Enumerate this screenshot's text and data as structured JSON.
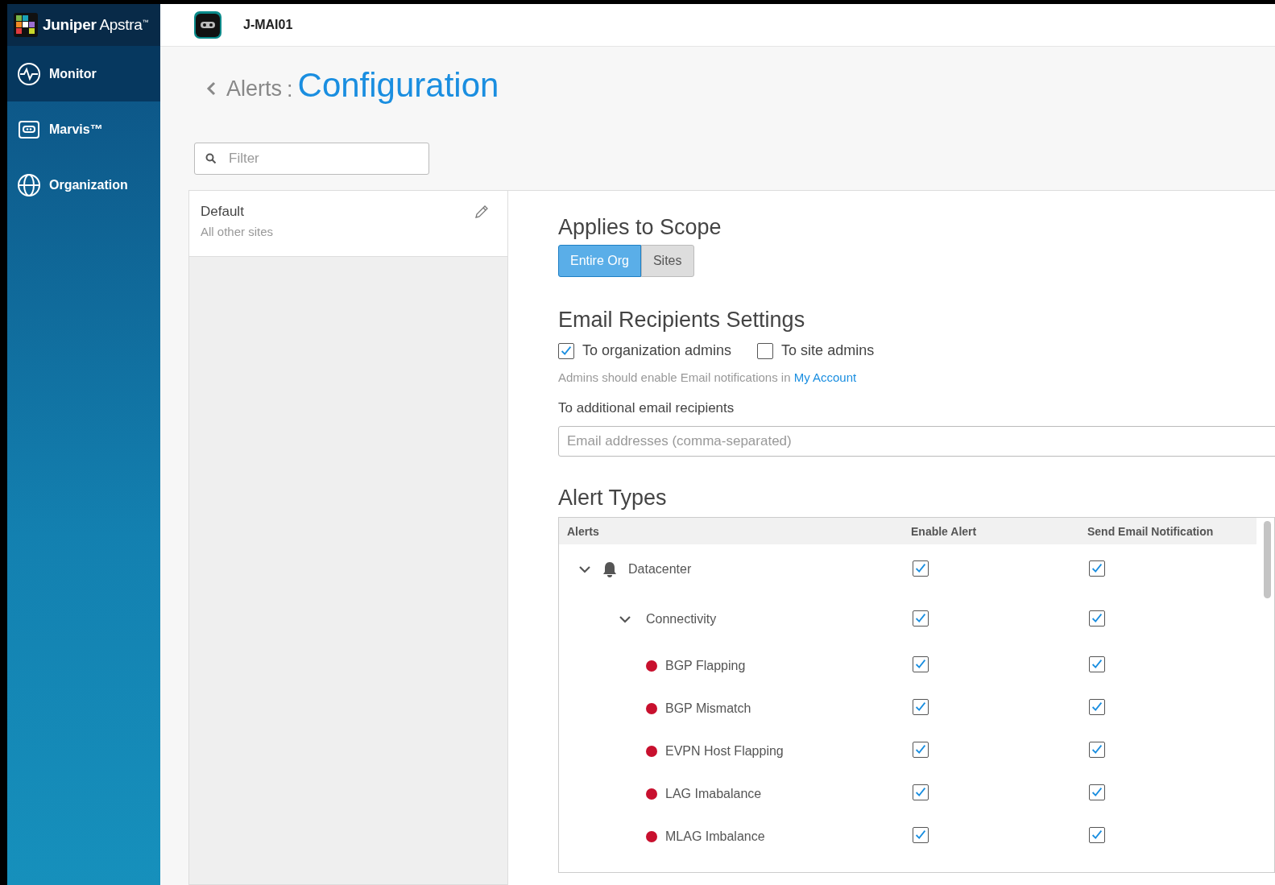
{
  "brand": {
    "name": "Juniper",
    "product": "Apstra",
    "mark": "™"
  },
  "header": {
    "org_name": "J-MAI01"
  },
  "sidebar": {
    "items": [
      {
        "label": "Monitor",
        "selected": true
      },
      {
        "label": "Marvis™",
        "selected": false
      },
      {
        "label": "Organization",
        "selected": false
      }
    ]
  },
  "breadcrumb": {
    "back": "Alerts",
    "separator": ":",
    "title": "Configuration"
  },
  "filter": {
    "placeholder": "Filter"
  },
  "templates": [
    {
      "name": "Default",
      "subtitle": "All other sites",
      "selected": true
    }
  ],
  "scope": {
    "heading": "Applies to Scope",
    "options": [
      {
        "label": "Entire Org",
        "selected": true
      },
      {
        "label": "Sites",
        "selected": false
      }
    ]
  },
  "email": {
    "heading": "Email Recipients Settings",
    "recipients": [
      {
        "label": "To organization admins",
        "checked": true
      },
      {
        "label": "To site admins",
        "checked": false
      }
    ],
    "hint": "Admins should enable Email notifications in",
    "hint_link": "My Account",
    "additional_label": "To additional email recipients",
    "additional_placeholder": "Email addresses (comma-separated)"
  },
  "alert_types": {
    "heading": "Alert Types",
    "columns": [
      "Alerts",
      "Enable Alert",
      "Send Email Notification"
    ],
    "rows": [
      {
        "name": "Datacenter",
        "kind": "category",
        "expanded": true,
        "enabled": true,
        "email": true,
        "children": [
          {
            "name": "Connectivity",
            "kind": "group",
            "expanded": true,
            "enabled": true,
            "email": true,
            "children": [
              {
                "name": "BGP Flapping",
                "kind": "alert",
                "color": "#c8102e",
                "enabled": true,
                "email": true
              },
              {
                "name": "BGP Mismatch",
                "kind": "alert",
                "color": "#c8102e",
                "enabled": true,
                "email": true
              },
              {
                "name": "EVPN Host Flapping",
                "kind": "alert",
                "color": "#c8102e",
                "enabled": true,
                "email": true
              },
              {
                "name": "LAG Imabalance",
                "kind": "alert",
                "color": "#c8102e",
                "enabled": true,
                "email": true
              },
              {
                "name": "MLAG Imbalance",
                "kind": "alert",
                "color": "#c8102e",
                "enabled": true,
                "email": true
              }
            ]
          }
        ]
      }
    ]
  }
}
